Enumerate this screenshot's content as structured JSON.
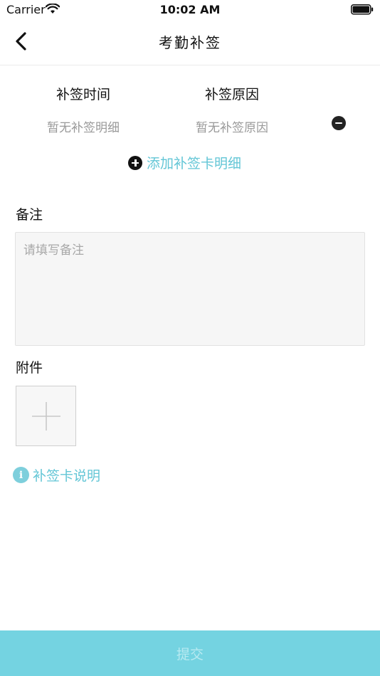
{
  "status_bar": {
    "carrier": "Carrier",
    "time": "10:02 AM",
    "wifi_icon": "wifi-icon",
    "battery_icon": "battery-icon"
  },
  "nav": {
    "back_icon": "chevron-left-icon",
    "title": "考勤补签"
  },
  "detail_table": {
    "columns": [
      "补签时间",
      "补签原因"
    ],
    "rows": [
      {
        "time": "暂无补签明细",
        "reason": "暂无补签原因",
        "remove_icon": "minus-circle-icon"
      }
    ],
    "add_label": "添加补签卡明细",
    "add_icon": "plus-circle-icon"
  },
  "remark": {
    "label": "备注",
    "value": "",
    "placeholder": "请填写备注"
  },
  "attachment": {
    "label": "附件",
    "upload_icon": "plus-icon"
  },
  "info": {
    "icon": "info-icon",
    "label": "补签卡说明"
  },
  "submit": {
    "label": "提交"
  },
  "colors": {
    "accent": "#63c6d6",
    "submit_bg": "#74d3e1",
    "submit_text": "#b8eaf1"
  }
}
